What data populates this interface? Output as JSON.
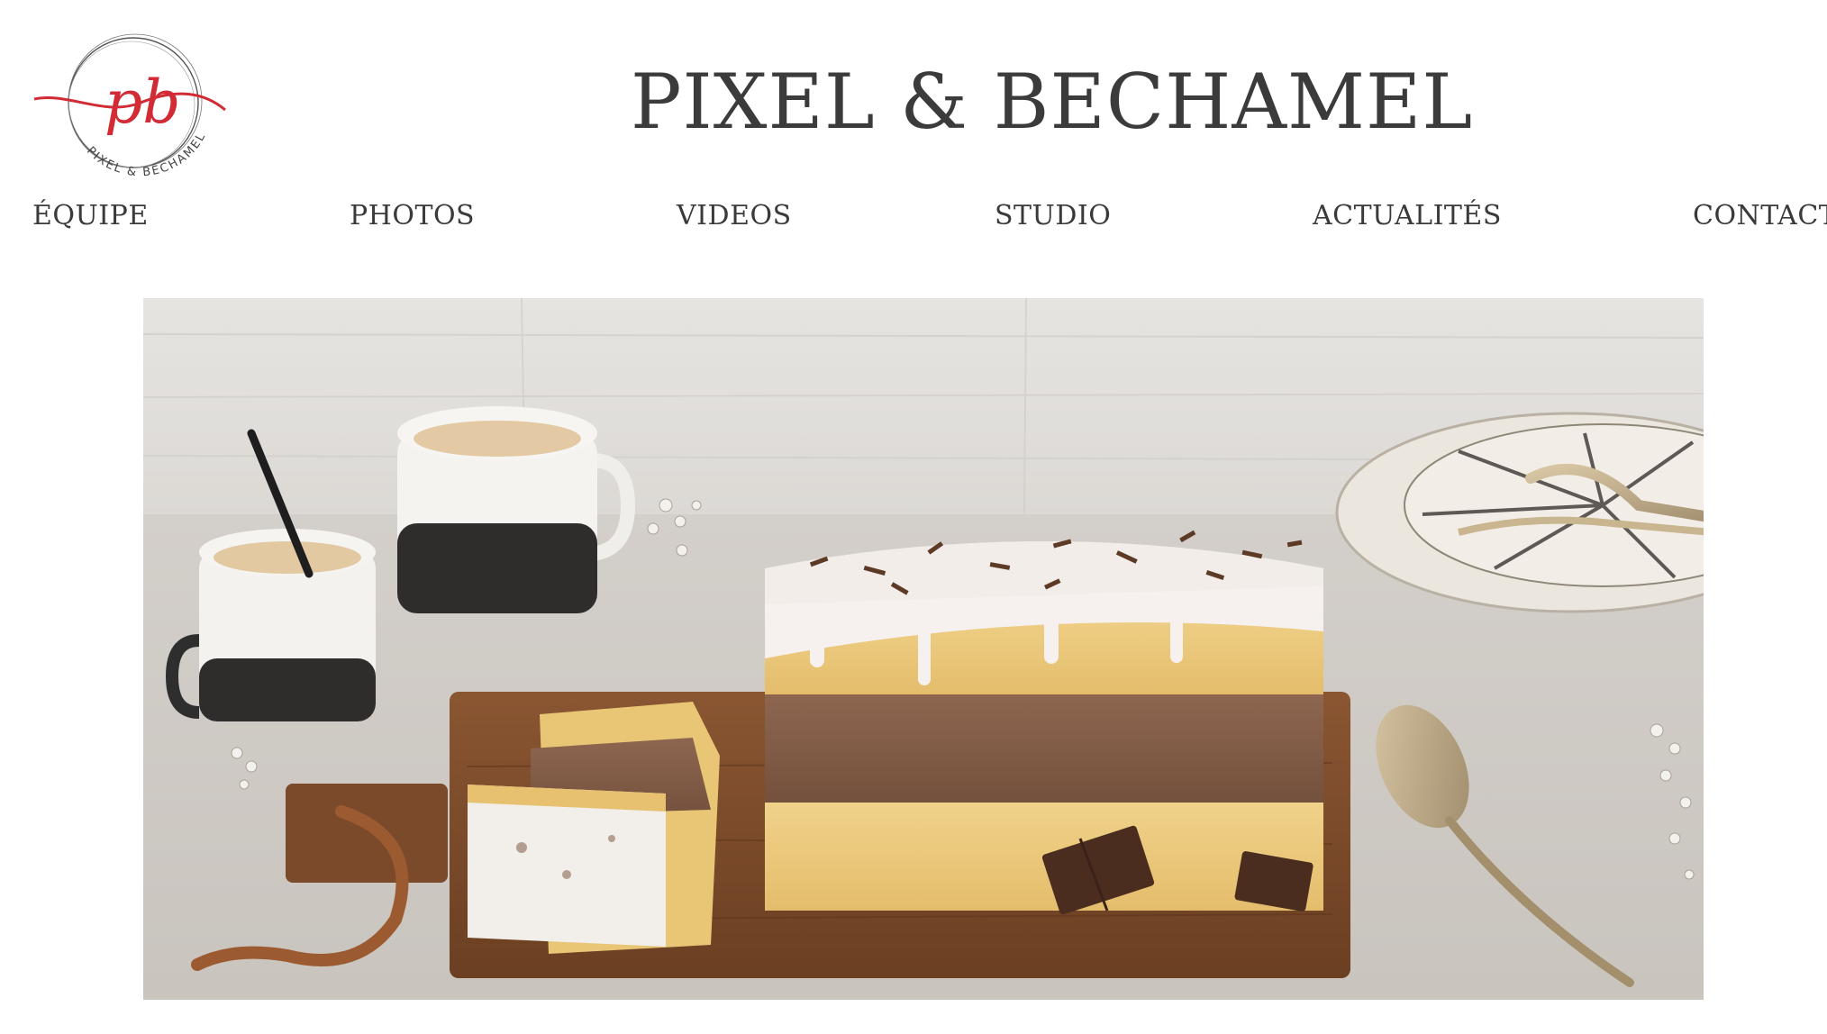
{
  "brand": {
    "logo_monogram": "pb",
    "logo_ring_text": "PIXEL & BÉCHAMEL",
    "title": "PIXEL & BECHAMEL",
    "accent_color": "#d22b35"
  },
  "nav": {
    "items": [
      {
        "label": "ÉQUIPE"
      },
      {
        "label": "PHOTOS"
      },
      {
        "label": "VIDEOS"
      },
      {
        "label": "STUDIO"
      },
      {
        "label": "ACTUALITÉS"
      },
      {
        "label": "CONTACT"
      }
    ]
  },
  "hero": {
    "image_icon": "marble-cake-photo"
  }
}
